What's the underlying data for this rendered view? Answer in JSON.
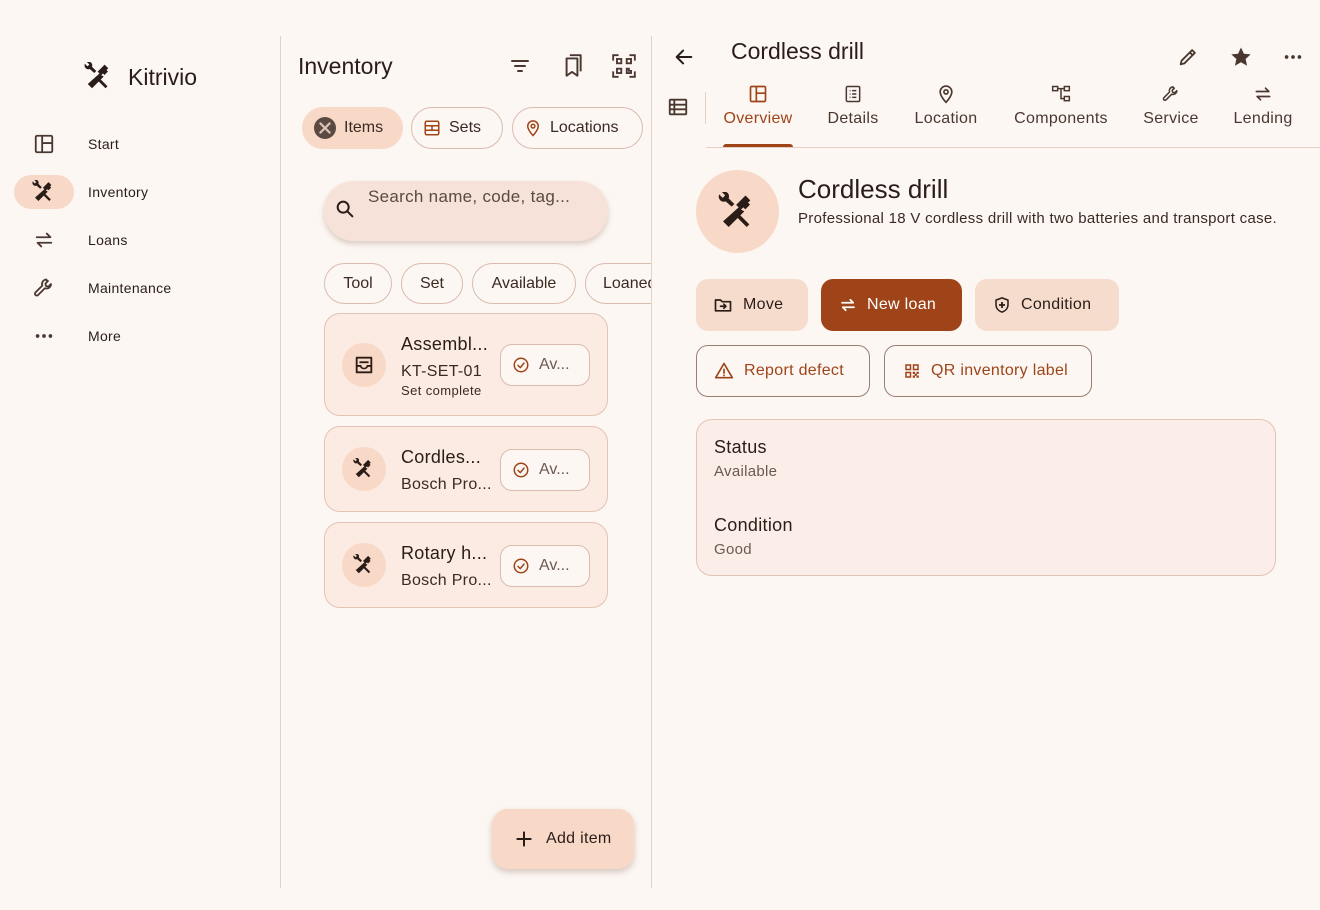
{
  "app": {
    "name": "Kitrivio"
  },
  "sidebar": {
    "items": [
      {
        "label": "Start",
        "icon": "dashboard-icon"
      },
      {
        "label": "Inventory",
        "icon": "tools-icon",
        "active": true
      },
      {
        "label": "Loans",
        "icon": "swap-icon"
      },
      {
        "label": "Maintenance",
        "icon": "wrench-icon"
      },
      {
        "label": "More",
        "icon": "more-horizontal-icon"
      }
    ]
  },
  "inventory": {
    "title": "Inventory",
    "segments": [
      {
        "label": "Items",
        "active": true
      },
      {
        "label": "Sets"
      },
      {
        "label": "Locations"
      }
    ],
    "search": {
      "placeholder": "Search name, code, tag..."
    },
    "filter_chips": [
      "Tool",
      "Set",
      "Available",
      "Loaned"
    ],
    "items": [
      {
        "title": "Assembl...",
        "code": "KT-SET-01",
        "note": "Set complete",
        "status": "Av..."
      },
      {
        "title": "Cordles...",
        "subtitle": "Bosch Pro...",
        "status": "Av..."
      },
      {
        "title": "Rotary h...",
        "subtitle": "Bosch Pro...",
        "status": "Av..."
      }
    ],
    "fab_label": "Add item"
  },
  "detail": {
    "title": "Cordless drill",
    "tabs": [
      {
        "label": "Overview",
        "active": true
      },
      {
        "label": "Details"
      },
      {
        "label": "Location"
      },
      {
        "label": "Components"
      },
      {
        "label": "Service"
      },
      {
        "label": "Lending"
      }
    ],
    "name": "Cordless drill",
    "description": "Professional 18 V cordless drill with two batteries and transport case.",
    "actions": {
      "move": "Move",
      "new_loan": "New loan",
      "condition": "Condition",
      "report_defect": "Report defect",
      "qr_label": "QR inventory label"
    },
    "info": {
      "status_label": "Status",
      "status_value": "Available",
      "condition_label": "Condition",
      "condition_value": "Good"
    }
  },
  "colors": {
    "background": "#fdf7f3",
    "accent": "#9e4418",
    "tonal": "#f8d8c6",
    "card": "#fbebe3"
  }
}
